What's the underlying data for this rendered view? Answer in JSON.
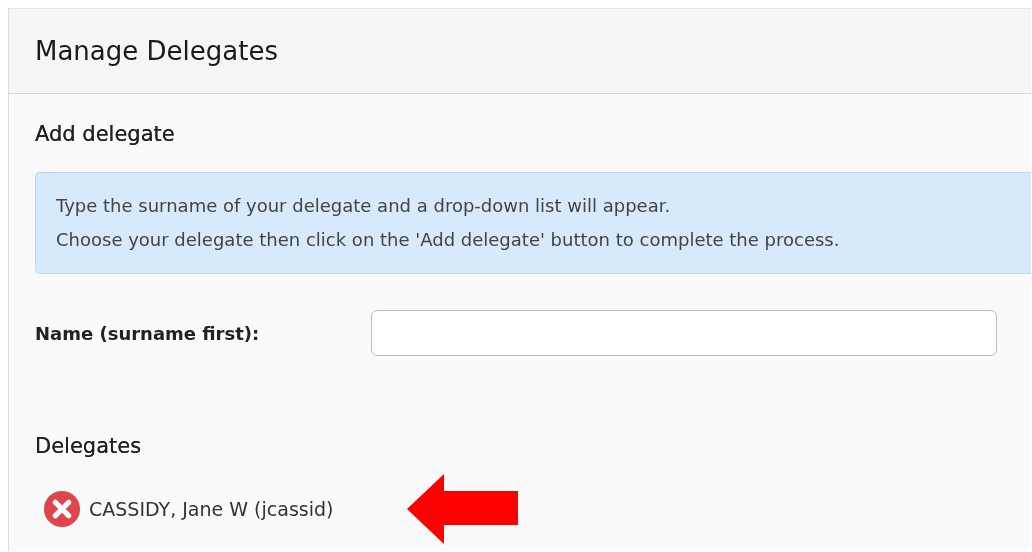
{
  "panel": {
    "title": "Manage Delegates"
  },
  "add_section": {
    "heading": "Add delegate",
    "info_lines": [
      "Type the surname of your delegate and a drop-down list will appear.",
      "Choose your delegate then click on the 'Add delegate' button to complete the process."
    ],
    "name_field": {
      "label": "Name (surname first):"
    }
  },
  "delegates": {
    "heading": "Delegates",
    "items": [
      {
        "name": "CASSIDY, Jane W (jcassid)",
        "annotated": true
      }
    ]
  }
}
